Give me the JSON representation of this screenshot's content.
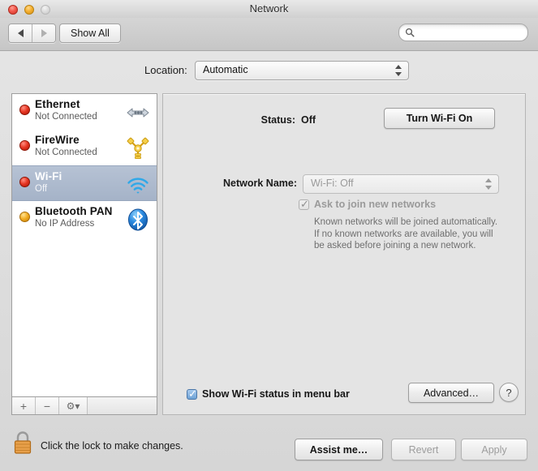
{
  "window": {
    "title": "Network",
    "traffic_lights": [
      "close",
      "minimize",
      "zoom"
    ]
  },
  "toolbar": {
    "back_icon": "triangle-left-icon",
    "forward_icon": "triangle-right-icon",
    "show_all_label": "Show All",
    "search": {
      "icon": "search-icon",
      "value": "",
      "placeholder": ""
    }
  },
  "location": {
    "label": "Location:",
    "value": "Automatic"
  },
  "sidebar": {
    "services": [
      {
        "name": "Ethernet",
        "status": "Not Connected",
        "dot": "red",
        "icon": "ethernet-icon",
        "selected": false
      },
      {
        "name": "FireWire",
        "status": "Not Connected",
        "dot": "red",
        "icon": "firewire-icon",
        "selected": false
      },
      {
        "name": "Wi-Fi",
        "status": "Off",
        "dot": "red",
        "icon": "wifi-icon",
        "selected": true
      },
      {
        "name": "Bluetooth PAN",
        "status": "No IP Address",
        "dot": "amber",
        "icon": "bluetooth-icon",
        "selected": false
      }
    ],
    "footer": {
      "add_label": "+",
      "remove_label": "−",
      "gear_label": "⚙▾"
    }
  },
  "panel": {
    "status_label": "Status:",
    "status_value": "Off",
    "turn_wifi_button": "Turn Wi-Fi On",
    "network_name_label": "Network Name:",
    "network_name_value": "Wi-Fi: Off",
    "ask_to_join_label": "Ask to join new networks",
    "ask_to_join_checked": true,
    "ask_to_join_enabled": false,
    "ask_to_join_help": "Known networks will be joined automatically. If no known networks are available, you will be asked before joining a new network.",
    "show_status_label": "Show Wi-Fi status in menu bar",
    "show_status_checked": true,
    "advanced_label": "Advanced…",
    "help_label": "?"
  },
  "bottom": {
    "lock_icon": "lock-closed-icon",
    "lock_text": "Click the lock to make changes.",
    "assist_label": "Assist me…",
    "revert_label": "Revert",
    "apply_label": "Apply"
  },
  "colors": {
    "selection": "#a5b3c8",
    "checkbox_on": "#6ea2d6",
    "dot_red": "#e63522",
    "dot_amber": "#f2ac21",
    "lock_body": "#e08b2e",
    "bluetooth_blue": "#2b8ae0"
  }
}
